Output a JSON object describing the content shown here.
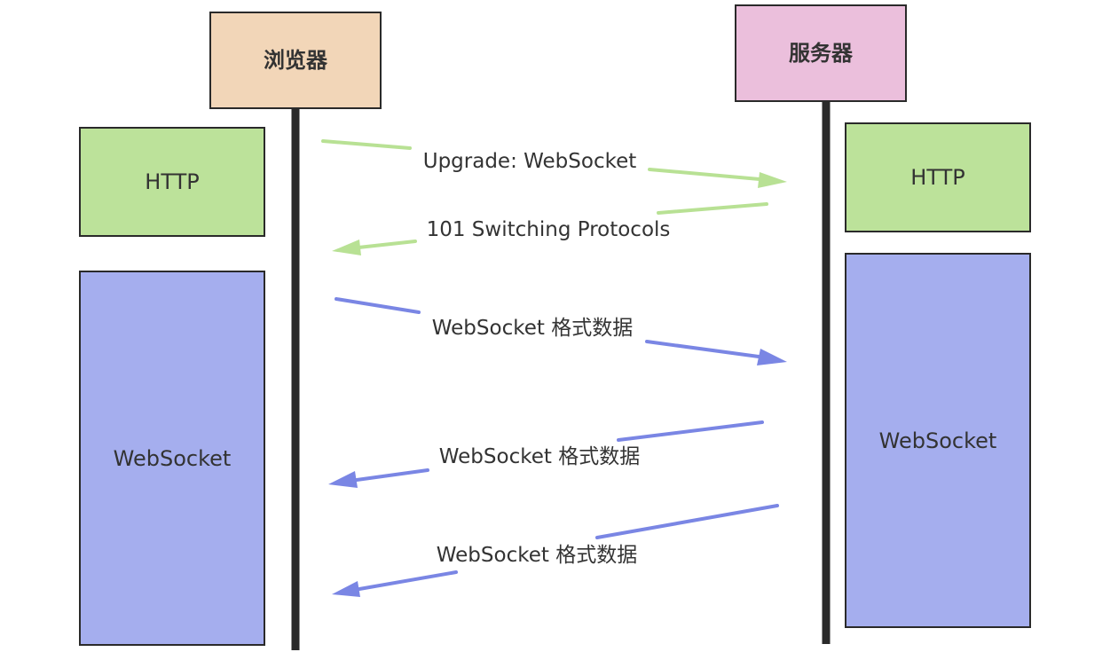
{
  "actors": {
    "browser": {
      "label": "浏览器",
      "color": "#f2d6b8"
    },
    "server": {
      "label": "服务器",
      "color": "#ebbfdc"
    }
  },
  "boxes": {
    "browser_http": {
      "label": "HTTP",
      "color": "#bce29a"
    },
    "browser_websocket": {
      "label": "WebSocket",
      "color": "#a5aeee"
    },
    "server_http": {
      "label": "HTTP",
      "color": "#bce29a"
    },
    "server_websocket": {
      "label": "WebSocket",
      "color": "#a5aeee"
    }
  },
  "messages": [
    {
      "label": "Upgrade: WebSocket",
      "direction": "browser-to-server",
      "color": "#b8e194"
    },
    {
      "label": "101 Switching Protocols",
      "direction": "server-to-browser",
      "color": "#b8e194"
    },
    {
      "label": "WebSocket 格式数据",
      "direction": "browser-to-server",
      "color": "#7a86e4"
    },
    {
      "label": "WebSocket 格式数据",
      "direction": "server-to-browser",
      "color": "#7a86e4"
    },
    {
      "label": "WebSocket 格式数据",
      "direction": "server-to-browser",
      "color": "#7a86e4"
    }
  ],
  "colors": {
    "lifeline": "#2a2a2a",
    "border": "#2a2a2a",
    "text": "#333333"
  }
}
